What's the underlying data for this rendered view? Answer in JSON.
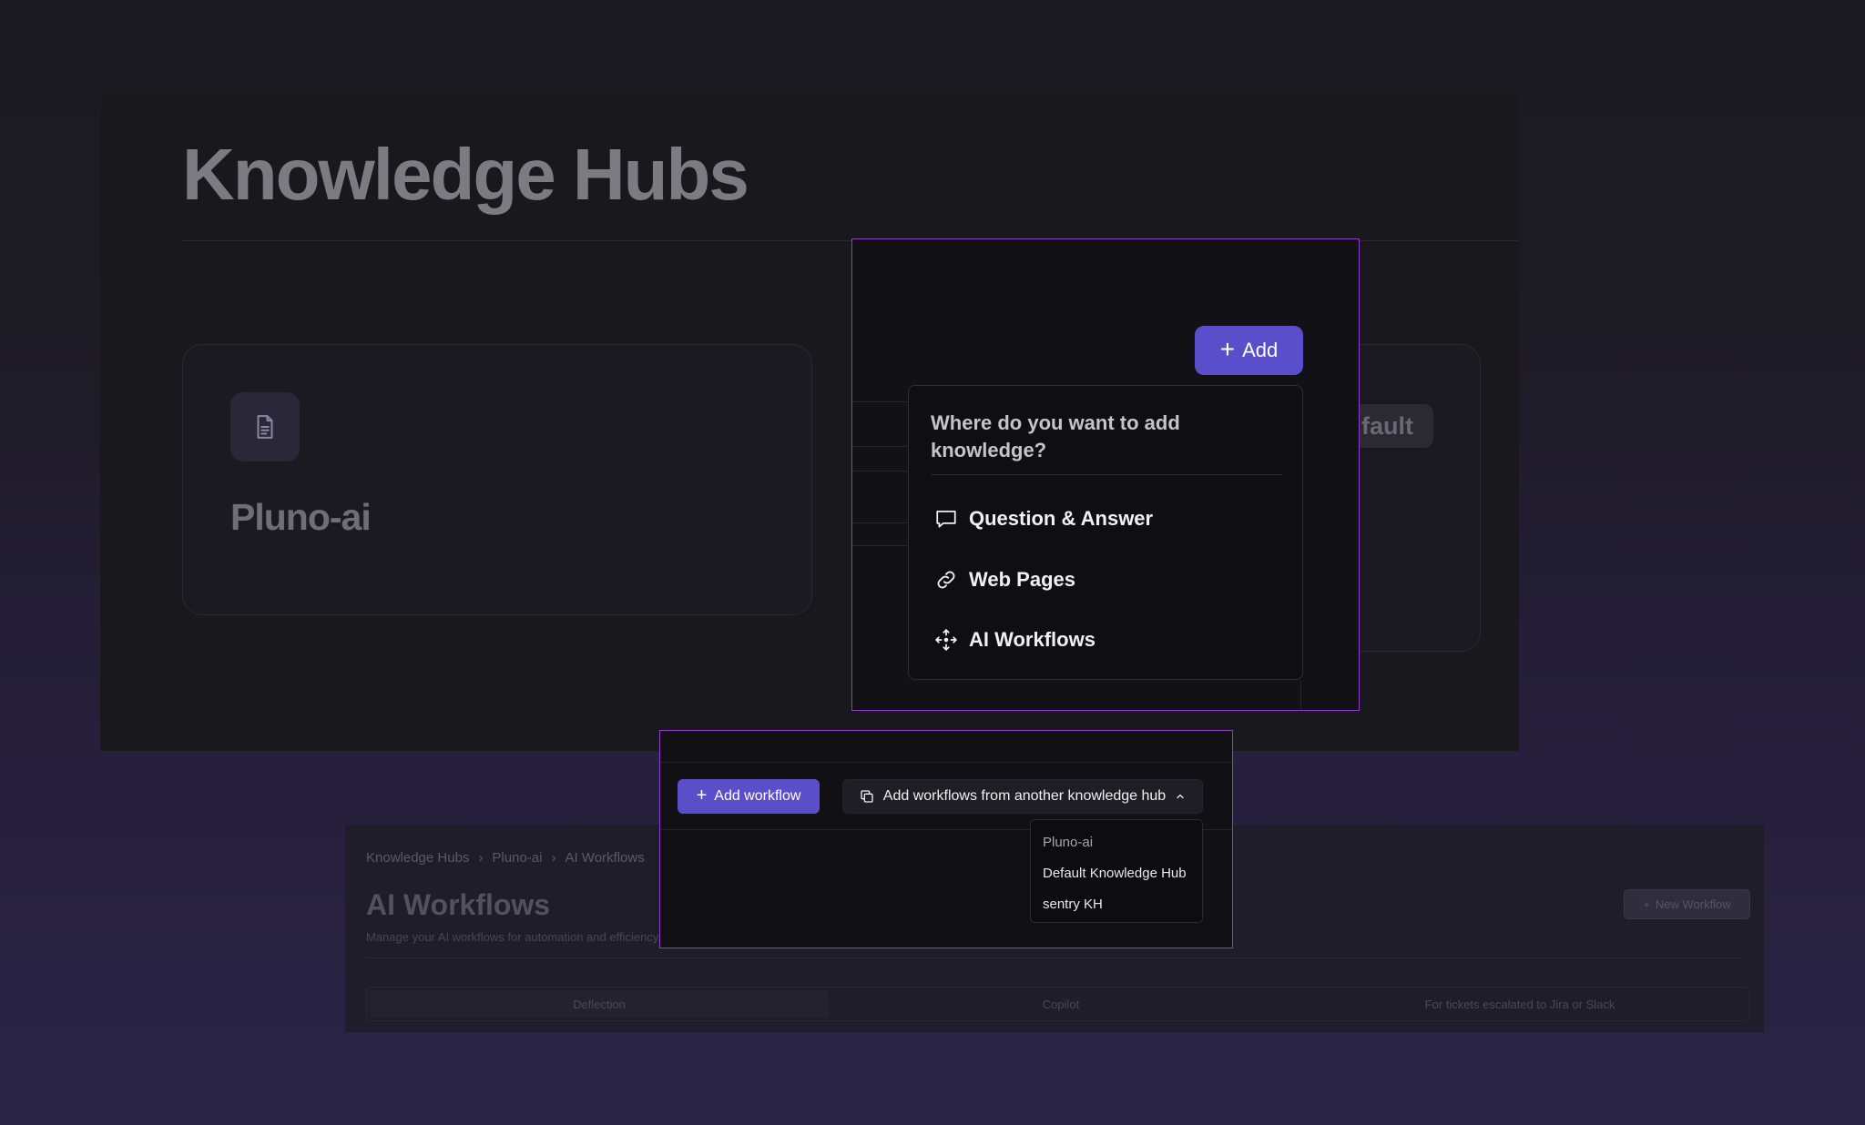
{
  "page": {
    "title": "Knowledge Hubs"
  },
  "hubs": [
    {
      "name": "Pluno-ai"
    },
    {
      "badge": "fault"
    }
  ],
  "add_button": {
    "label": "Add"
  },
  "add_menu": {
    "heading": "Where do you want to add knowledge?",
    "items": [
      {
        "label": "Question & Answer",
        "icon": "chat-bubble-icon"
      },
      {
        "label": "Web Pages",
        "icon": "link-icon"
      },
      {
        "label": "AI Workflows",
        "icon": "move-arrows-icon"
      }
    ]
  },
  "workflow_toolbar": {
    "add_workflow_label": "Add workflow",
    "import_label": "Add workflows from another knowledge hub",
    "dropdown_options": [
      "Pluno-ai",
      "Default Knowledge Hub",
      "sentry KH"
    ]
  },
  "workflows_page": {
    "breadcrumb": [
      "Knowledge Hubs",
      "Pluno-ai",
      "AI Workflows"
    ],
    "title": "AI Workflows",
    "subtitle": "Manage your AI workflows for automation and efficiency.",
    "new_workflow_label": "New Workflow",
    "tabs": [
      "Deflection",
      "Copilot",
      "For tickets escalated to Jira or Slack"
    ]
  },
  "colors": {
    "accent": "#5b4ecb",
    "highlight_border": "#8b3fc9"
  }
}
